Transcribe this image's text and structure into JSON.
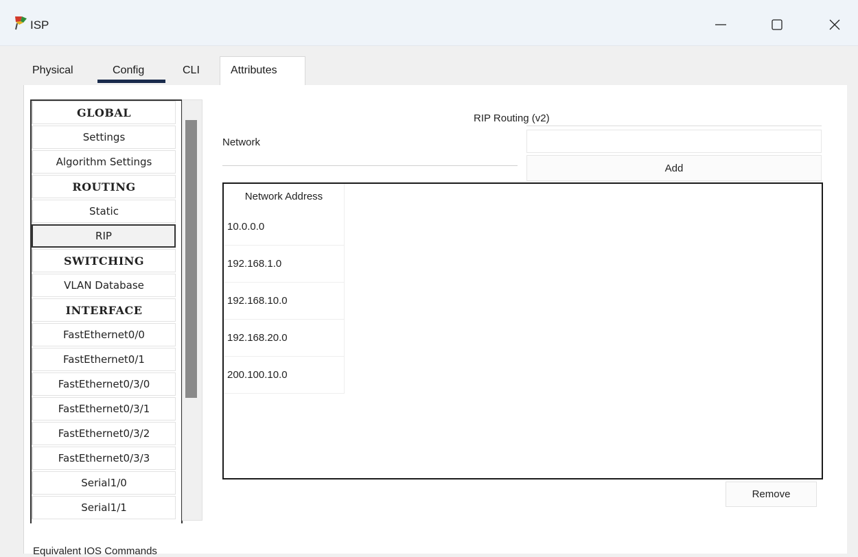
{
  "window": {
    "title": "ISP",
    "icon": "packet-tracer-router-icon"
  },
  "tabs": [
    {
      "label": "Physical"
    },
    {
      "label": "Config"
    },
    {
      "label": "CLI"
    },
    {
      "label": "Attributes"
    }
  ],
  "active_tab": "Config",
  "sidebar": {
    "items": [
      {
        "label": "GLOBAL",
        "type": "header"
      },
      {
        "label": "Settings",
        "type": "item"
      },
      {
        "label": "Algorithm Settings",
        "type": "item"
      },
      {
        "label": "ROUTING",
        "type": "header"
      },
      {
        "label": "Static",
        "type": "item"
      },
      {
        "label": "RIP",
        "type": "item",
        "selected": true
      },
      {
        "label": "SWITCHING",
        "type": "header"
      },
      {
        "label": "VLAN Database",
        "type": "item"
      },
      {
        "label": "INTERFACE",
        "type": "header"
      },
      {
        "label": "FastEthernet0/0",
        "type": "item"
      },
      {
        "label": "FastEthernet0/1",
        "type": "item"
      },
      {
        "label": "FastEthernet0/3/0",
        "type": "item"
      },
      {
        "label": "FastEthernet0/3/1",
        "type": "item"
      },
      {
        "label": "FastEthernet0/3/2",
        "type": "item"
      },
      {
        "label": "FastEthernet0/3/3",
        "type": "item"
      },
      {
        "label": "Serial1/0",
        "type": "item"
      },
      {
        "label": "Serial1/1",
        "type": "item"
      }
    ]
  },
  "rip": {
    "title": "RIP Routing (v2)",
    "network_label": "Network",
    "network_value": "",
    "add_label": "Add",
    "table_header": "Network Address",
    "networks": [
      "10.0.0.0",
      "192.168.1.0",
      "192.168.10.0",
      "192.168.20.0",
      "200.100.10.0"
    ],
    "remove_label": "Remove"
  },
  "footer": {
    "label": "Equivalent IOS Commands"
  }
}
